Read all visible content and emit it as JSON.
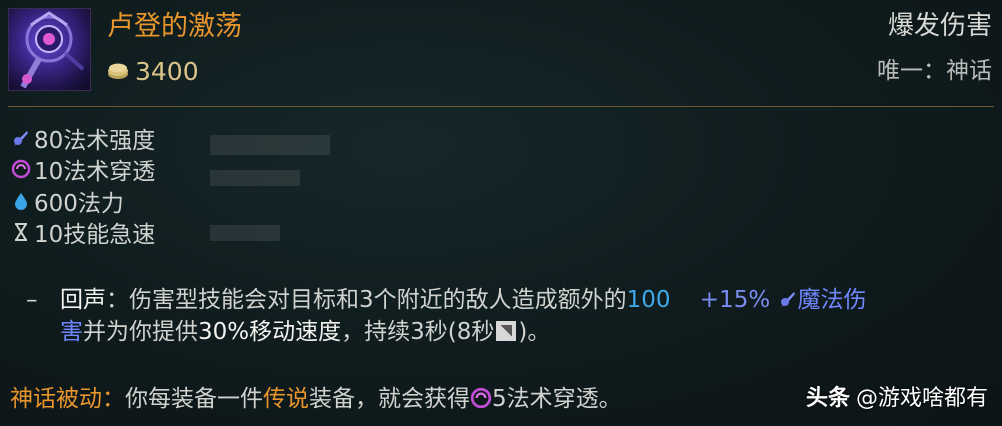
{
  "item": {
    "name": "卢登的激荡",
    "cost": "3400",
    "category": "爆发伤害",
    "rarity": "唯一：神话"
  },
  "stats": [
    {
      "icon": "ability-power-icon",
      "text": "80法术强度"
    },
    {
      "icon": "magic-penetration-icon",
      "text": "10法术穿透"
    },
    {
      "icon": "mana-icon",
      "text": "600法力"
    },
    {
      "icon": "ability-haste-icon",
      "text": "10技能急速"
    }
  ],
  "passive": {
    "dash": "–",
    "name": "回声",
    "colon": "：",
    "text1": "伤害型技能会对目标和3个附近的敌人造成额外的",
    "damage": "100",
    "scaling": "+15%",
    "damage_type": "魔法伤",
    "damage_type_end": "害",
    "text2": "并为你提供",
    "speed": "30%移动速度",
    "text3": "，持续3秒(8秒",
    "text4": ")。"
  },
  "mythic": {
    "label": "神话被动",
    "colon": "：",
    "text1": "你每装备一件",
    "legendary": "传说",
    "text2": "装备，就会获得",
    "bonus": "5法术穿透。"
  },
  "watermark": {
    "brand": "头条",
    "handle": "@游戏啥都有"
  },
  "colors": {
    "item_name": "#e8952c",
    "magic_damage": "#3fa9e8",
    "magic_type": "#6f86ff",
    "divider": "#6b5a2e"
  }
}
